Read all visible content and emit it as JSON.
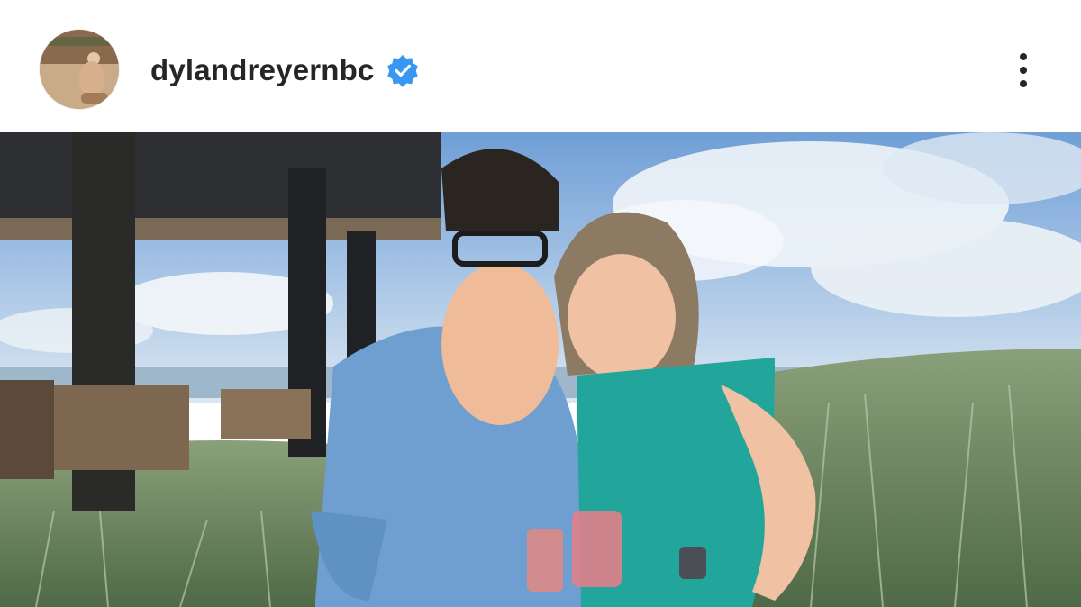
{
  "post_header": {
    "username": "dylandreyernbc",
    "verified_icon": "verified-badge-icon",
    "avatar_icon": "profile-avatar",
    "more_icon": "more-options-icon"
  },
  "post": {
    "media_icon": "post-photo",
    "verified_color": "#3897f0"
  }
}
